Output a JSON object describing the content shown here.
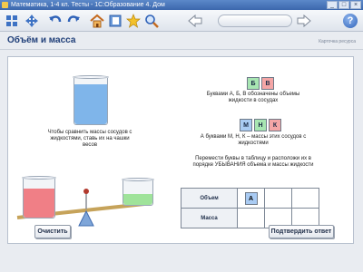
{
  "window": {
    "title": "Математика, 1-4 кл. Тесты - 1С:Образование 4. Дом"
  },
  "header": {
    "title": "Объём и масса",
    "card_link": "Карточка ресурса"
  },
  "instructions": {
    "compare": "Чтобы сравнить массы сосудов с жидкостями, ставь их на чашки весов",
    "letters_bvv": "Буквами А, Б, В обозначены объемы жидкости в сосудах",
    "letters_mnk": "А буквами М, Н, К – массы этих сосудов с жидкостями",
    "move": "Перемести буквы в таблицу и расположи их в порядке УБЫВАНИЯ объема и массы жидкости"
  },
  "tiles": {
    "b": {
      "label": "Б",
      "color": "#a8e6b2"
    },
    "v": {
      "label": "В",
      "color": "#f5a6a6"
    },
    "m": {
      "label": "М",
      "color": "#a9cbf3"
    },
    "n": {
      "label": "Н",
      "color": "#a8e6b2"
    },
    "k": {
      "label": "К",
      "color": "#f5a6a6"
    }
  },
  "table": {
    "row1_label": "Объем",
    "row2_label": "Масса",
    "row1_cells": [
      "А",
      "",
      ""
    ],
    "row2_cells": [
      "",
      "",
      ""
    ]
  },
  "buttons": {
    "clear": "Очистить",
    "confirm": "Подтвердить ответ"
  },
  "colors": {
    "water_blue": "#7fb5ea",
    "water_red": "#f07f86",
    "water_green": "#9fe39a",
    "title_blue": "#1f3e78"
  }
}
